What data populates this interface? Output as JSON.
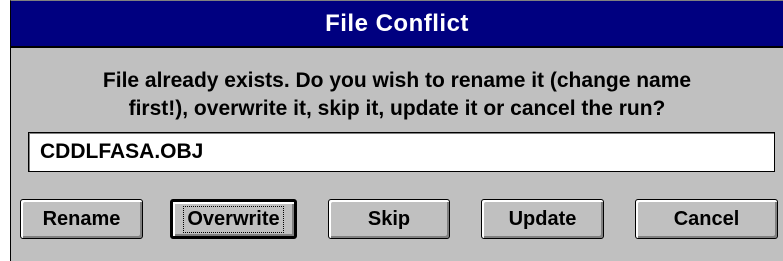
{
  "dialog": {
    "title": "File Conflict",
    "message_line1": "File already exists. Do you wish to rename it (change name",
    "message_line2": "first!), overwrite it, skip it, update it or cancel the run?",
    "filename_value": "CDDLFASA.OBJ"
  },
  "buttons": {
    "rename": "Rename",
    "overwrite": "Overwrite",
    "skip": "Skip",
    "update": "Update",
    "cancel": "Cancel"
  },
  "colors": {
    "title_bar": "#000080",
    "dialog_face": "#c0c0c0",
    "field_bg": "#ffffff"
  }
}
